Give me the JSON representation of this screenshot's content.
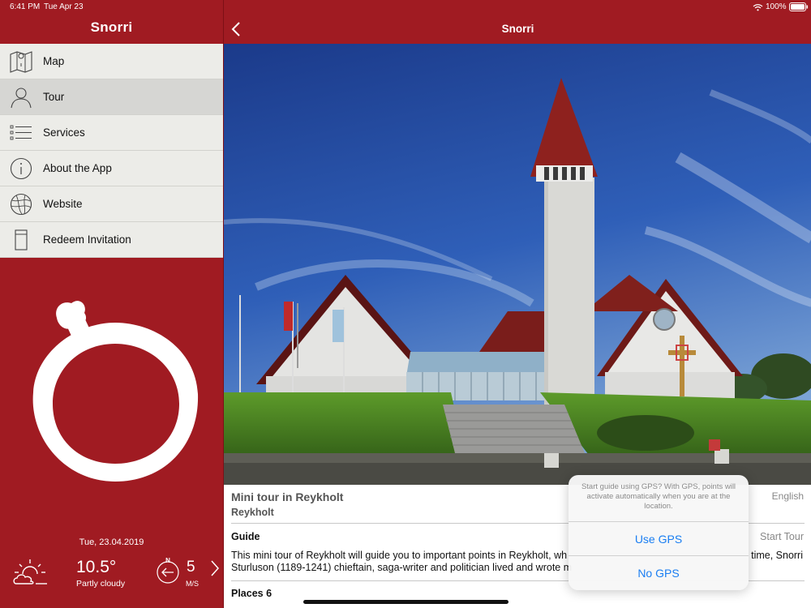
{
  "status_bar": {
    "time": "6:41 PM",
    "date": "Tue Apr 23",
    "battery": "100%"
  },
  "sidebar": {
    "title": "Snorri",
    "items": [
      {
        "label": "Map",
        "icon": "map-icon",
        "selected": false
      },
      {
        "label": "Tour",
        "icon": "person-icon",
        "selected": true
      },
      {
        "label": "Services",
        "icon": "list-icon",
        "selected": false
      },
      {
        "label": "About the App",
        "icon": "info-icon",
        "selected": false
      },
      {
        "label": "Website",
        "icon": "globe-icon",
        "selected": false
      },
      {
        "label": "Redeem Invitation",
        "icon": "card-icon",
        "selected": false
      }
    ],
    "logo": "snorri-ring-logo"
  },
  "weather": {
    "date": "Tue, 23.04.2019",
    "temperature": "10.5°",
    "condition": "Partly cloudy",
    "wind_direction": "N",
    "wind_speed": "5",
    "wind_unit": "M/S",
    "icon": "partly-cloudy-icon"
  },
  "detail": {
    "nav_title": "Snorri",
    "tour_title": "Mini tour in Reykholt",
    "location": "Reykholt",
    "language": "English",
    "guide_label": "Guide",
    "start_tour": "Start Tour",
    "guide_text_1": "This mini tour of Reykholt will guide you to important points in Reykholt, wh",
    "guide_text_1b": "time, Snorri",
    "guide_text_2": "Sturluson (1189-1241) chieftain, saga-writer and politician lived and wrote m",
    "places_label": "Places",
    "places_count": "6"
  },
  "gps_alert": {
    "message": "Start guide using GPS? With GPS, points will activate automatically when you are at the location.",
    "use_gps": "Use GPS",
    "no_gps": "No GPS"
  },
  "colors": {
    "brand_red": "#a01b22",
    "menu_bg": "#ecece8",
    "selected_bg": "#d6d6d3",
    "link_blue": "#1a7ef2"
  }
}
